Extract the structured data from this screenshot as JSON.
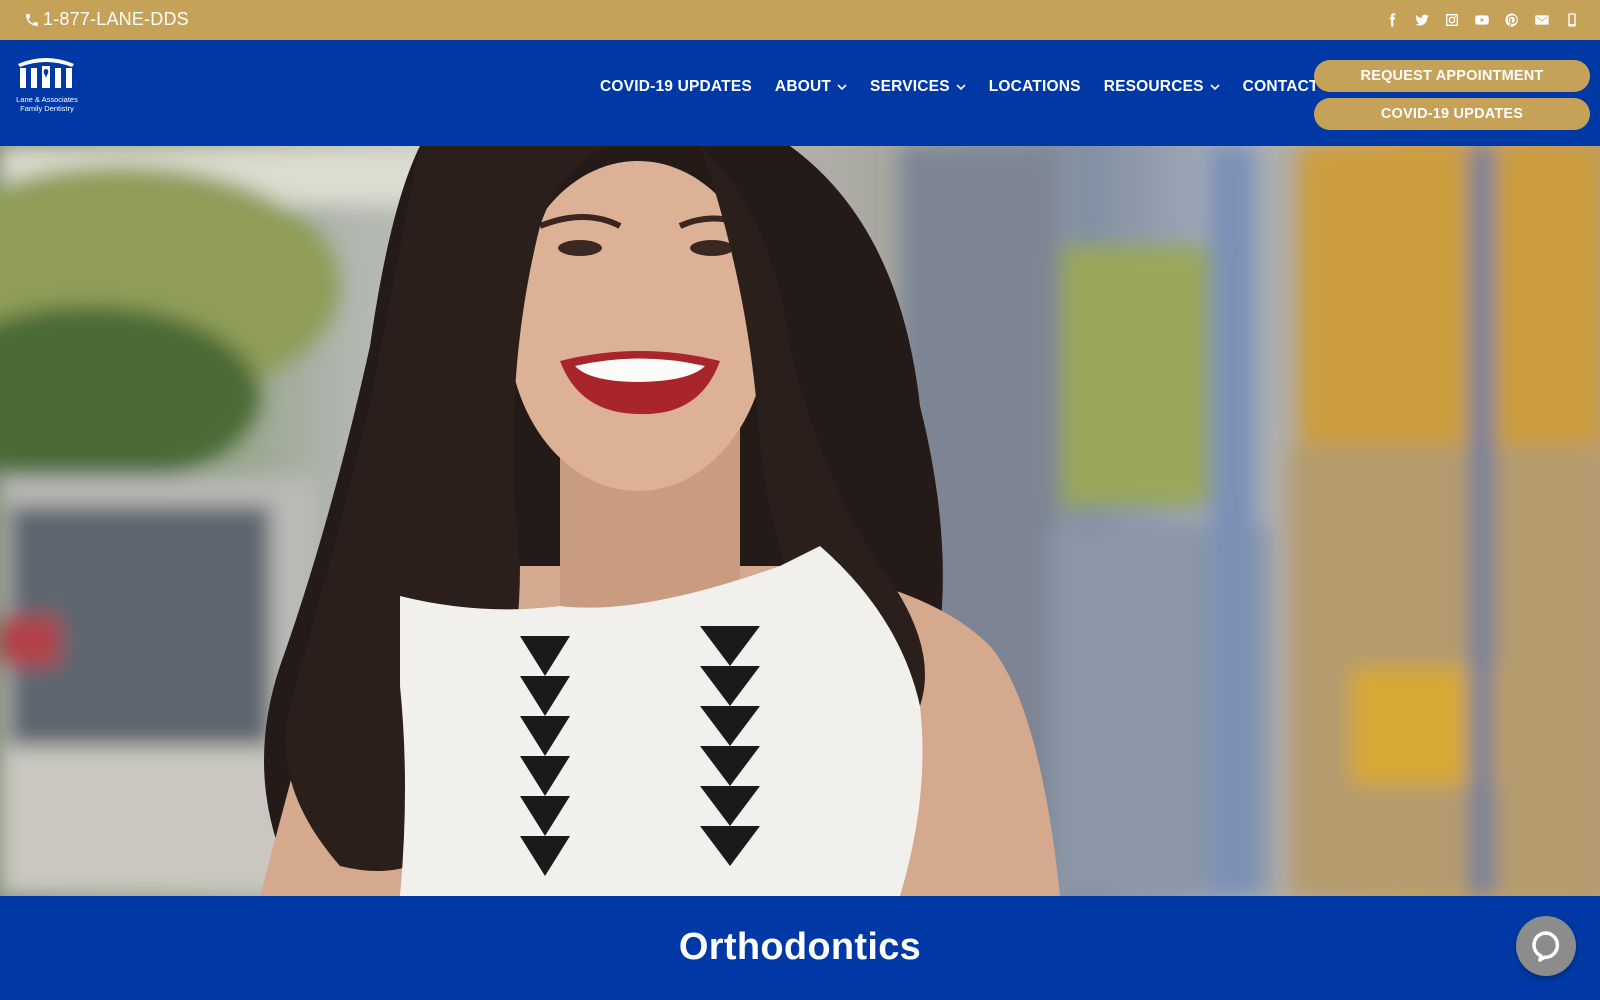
{
  "topbar": {
    "phone": "1-877-LANE-DDS",
    "socials": [
      "facebook-icon",
      "twitter-icon",
      "instagram-icon",
      "youtube-icon",
      "pinterest-icon",
      "email-icon",
      "mobile-icon"
    ]
  },
  "logo": {
    "line1": "Lane & Associates",
    "line2": "Family Dentistry"
  },
  "nav": {
    "items": [
      {
        "label": "COVID-19 UPDATES",
        "dropdown": false
      },
      {
        "label": "ABOUT",
        "dropdown": true
      },
      {
        "label": "SERVICES",
        "dropdown": true
      },
      {
        "label": "LOCATIONS",
        "dropdown": false
      },
      {
        "label": "RESOURCES",
        "dropdown": true
      },
      {
        "label": "CONTACT",
        "dropdown": false
      }
    ]
  },
  "cta": {
    "primary": "REQUEST APPOINTMENT",
    "secondary": "COVID-19 UPDATES"
  },
  "page": {
    "title": "Orthodontics"
  },
  "colors": {
    "gold": "#c6a258",
    "blue": "#0039a6",
    "white": "#ffffff"
  }
}
